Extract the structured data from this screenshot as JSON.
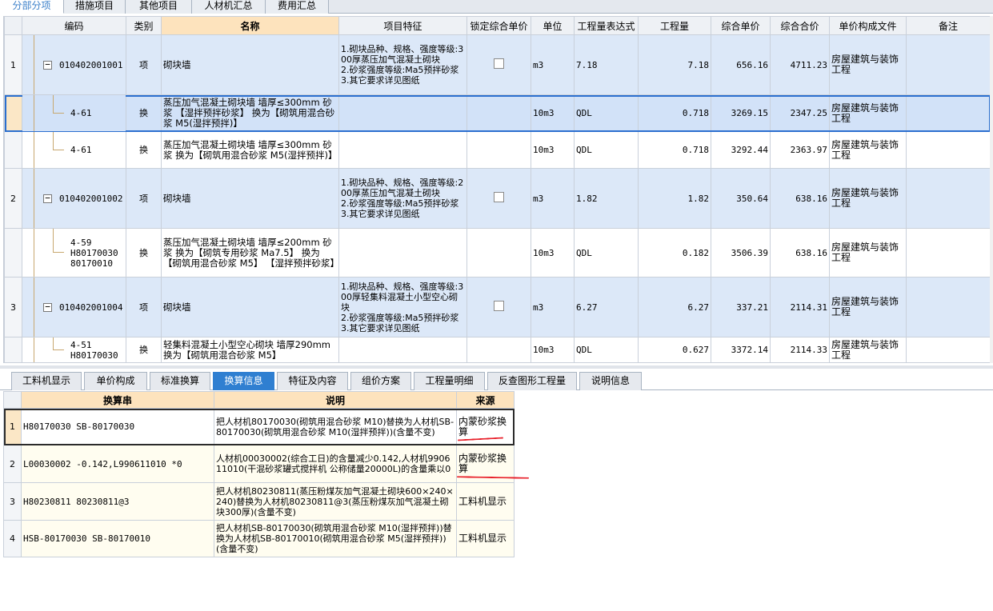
{
  "top_tabs": [
    "分部分项",
    "措施项目",
    "其他项目",
    "人材机汇总",
    "费用汇总"
  ],
  "top_active": 0,
  "columns": [
    "编码",
    "类别",
    "名称",
    "项目特征",
    "锁定综合单价",
    "单位",
    "工程量表达式",
    "工程量",
    "综合单价",
    "综合合价",
    "单价构成文件",
    "备注"
  ],
  "rows": [
    {
      "num": "1",
      "code": "010402001001",
      "type": "项",
      "name": "砌块墙",
      "feature": "1.砌块品种、规格、强度等级:300厚蒸压加气混凝土砌块\n2.砂浆强度等级:Ma5预拌砂浆\n3.其它要求详见图纸",
      "lock": true,
      "unit": "m3",
      "expr": "7.18",
      "qty": "7.18",
      "price": "656.16",
      "total": "4711.23",
      "file": "房屋建筑与装饰工程",
      "note": ""
    },
    {
      "num": "",
      "code": "4-61",
      "type": "换",
      "name": "蒸压加气混凝土砌块墙 墙厚≤300mm 砂浆 【湿拌预拌砂浆】 换为【砌筑用混合砂浆 M5(湿拌预拌)】",
      "feature": "",
      "lock": false,
      "unit": "10m3",
      "expr": "QDL",
      "qty": "0.718",
      "price": "3269.15",
      "total": "2347.25",
      "file": "房屋建筑与装饰工程",
      "note": ""
    },
    {
      "num": "",
      "code": "4-61",
      "type": "换",
      "name": "蒸压加气混凝土砌块墙 墙厚≤300mm 砂浆 换为【砌筑用混合砂浆 M5(湿拌预拌)】",
      "feature": "",
      "lock": false,
      "unit": "10m3",
      "expr": "QDL",
      "qty": "0.718",
      "price": "3292.44",
      "total": "2363.97",
      "file": "房屋建筑与装饰工程",
      "note": ""
    },
    {
      "num": "2",
      "code": "010402001002",
      "type": "项",
      "name": "砌块墙",
      "feature": "1.砌块品种、规格、强度等级:200厚蒸压加气混凝土砌块\n2.砂浆强度等级:Ma5预拌砂浆\n3.其它要求详见图纸",
      "lock": true,
      "unit": "m3",
      "expr": "1.82",
      "qty": "1.82",
      "price": "350.64",
      "total": "638.16",
      "file": "房屋建筑与装饰工程",
      "note": ""
    },
    {
      "num": "",
      "code": "4-59\nH80170030\n80170010",
      "type": "换",
      "name": "蒸压加气混凝土砌块墙 墙厚≤200mm 砂浆 换为【砌筑专用砂浆 Ma7.5】 换为【砌筑用混合砂浆 M5】 【湿拌预拌砂浆】",
      "feature": "",
      "lock": false,
      "unit": "10m3",
      "expr": "QDL",
      "qty": "0.182",
      "price": "3506.39",
      "total": "638.16",
      "file": "房屋建筑与装饰工程",
      "note": ""
    },
    {
      "num": "3",
      "code": "010402001004",
      "type": "项",
      "name": "砌块墙",
      "feature": "1.砌块品种、规格、强度等级:300厚轻集料混凝土小型空心砌块\n2.砂浆强度等级:Ma5预拌砂浆\n3.其它要求详见图纸",
      "lock": true,
      "unit": "m3",
      "expr": "6.27",
      "qty": "6.27",
      "price": "337.21",
      "total": "2114.31",
      "file": "房屋建筑与装饰工程",
      "note": ""
    },
    {
      "num": "",
      "code": "4-51\nH80170030",
      "type": "换",
      "name": "轻集料混凝土小型空心砌块 墙厚290mm 换为【砌筑用混合砂浆 M5】",
      "feature": "",
      "lock": false,
      "unit": "10m3",
      "expr": "QDL",
      "qty": "0.627",
      "price": "3372.14",
      "total": "2114.33",
      "file": "房屋建筑与装饰工程",
      "note": ""
    }
  ],
  "bottom_tabs": [
    "工料机显示",
    "单价构成",
    "标准换算",
    "换算信息",
    "特征及内容",
    "组价方案",
    "工程量明细",
    "反查图形工程量",
    "说明信息"
  ],
  "bottom_active": 3,
  "sub_columns": [
    "换算串",
    "说明",
    "来源"
  ],
  "sub_rows": [
    {
      "num": "1",
      "str": "H80170030 SB-80170030",
      "desc": "把人材机80170030(砌筑用混合砂浆 M10)替换为人材机SB-80170030(砌筑用混合砂浆 M10(湿拌预拌))(含量不变)",
      "src": "内蒙砂浆换算"
    },
    {
      "num": "2",
      "str": "L00030002 -0.142,L990611010 *0",
      "desc": "人材机00030002(综合工日)的含量减少0.142,人材机990611010(干混砂浆罐式搅拌机 公称储量20000L)的含量乘以0",
      "src": "内蒙砂浆换算"
    },
    {
      "num": "3",
      "str": "H80230811 80230811@3",
      "desc": "把人材机80230811(蒸压粉煤灰加气混凝土砌块600×240×240)替换为人材机80230811@3(蒸压粉煤灰加气混凝土砌块300厚)(含量不变)",
      "src": "工料机显示"
    },
    {
      "num": "4",
      "str": "HSB-80170030 SB-80170010",
      "desc": "把人材机SB-80170030(砌筑用混合砂浆 M10(湿拌预拌))替换为人材机SB-80170010(砌筑用混合砂浆 M5(湿拌预拌))(含量不变)",
      "src": "工料机显示"
    }
  ]
}
